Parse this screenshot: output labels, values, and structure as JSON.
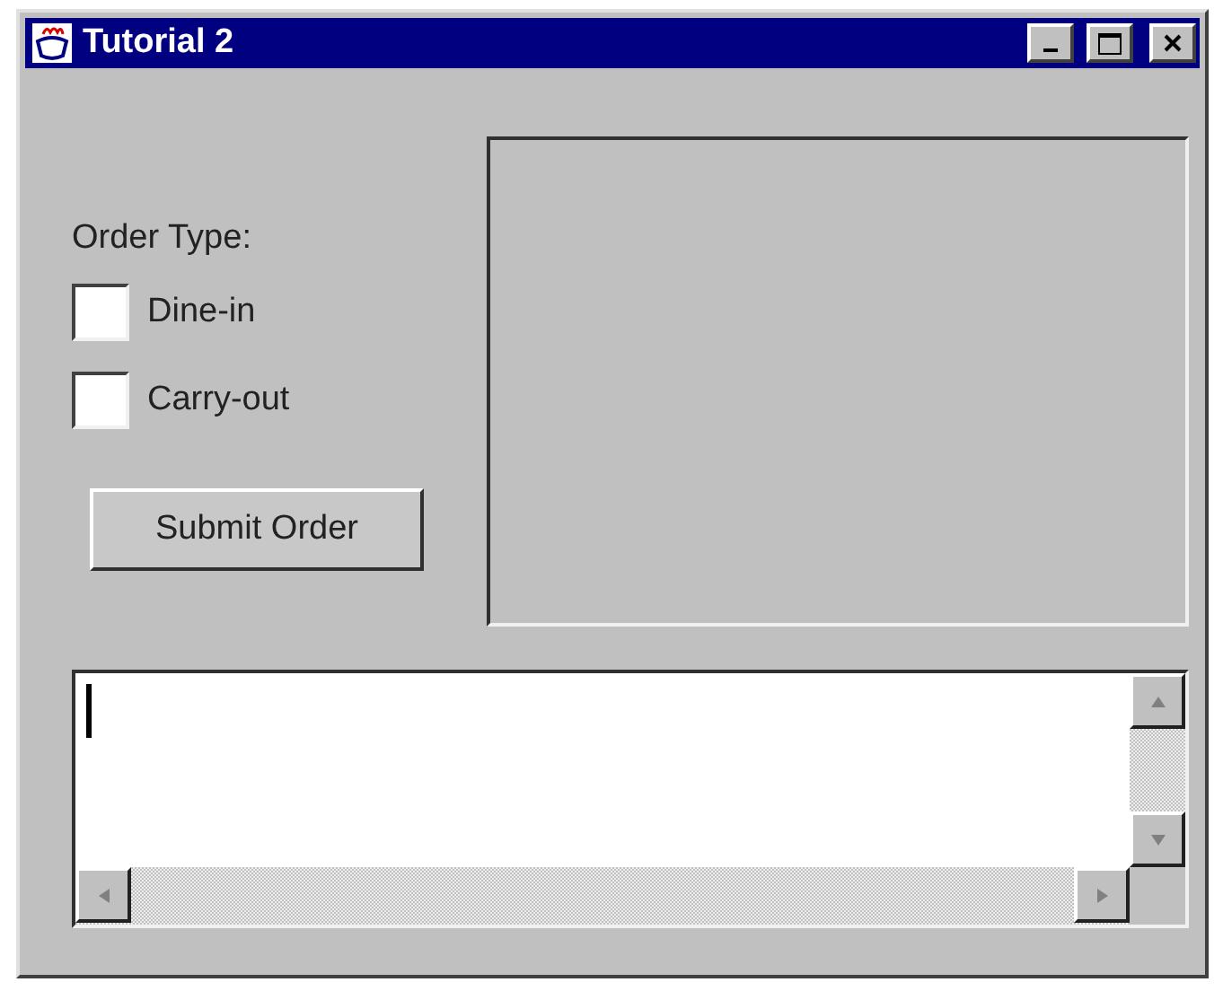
{
  "window": {
    "title": "Tutorial 2"
  },
  "order_type": {
    "label": "Order Type:",
    "options": [
      {
        "label": "Dine-in",
        "checked": false
      },
      {
        "label": "Carry-out",
        "checked": false
      }
    ]
  },
  "submit_button": {
    "label": "Submit Order"
  },
  "text_area": {
    "focused": true
  }
}
